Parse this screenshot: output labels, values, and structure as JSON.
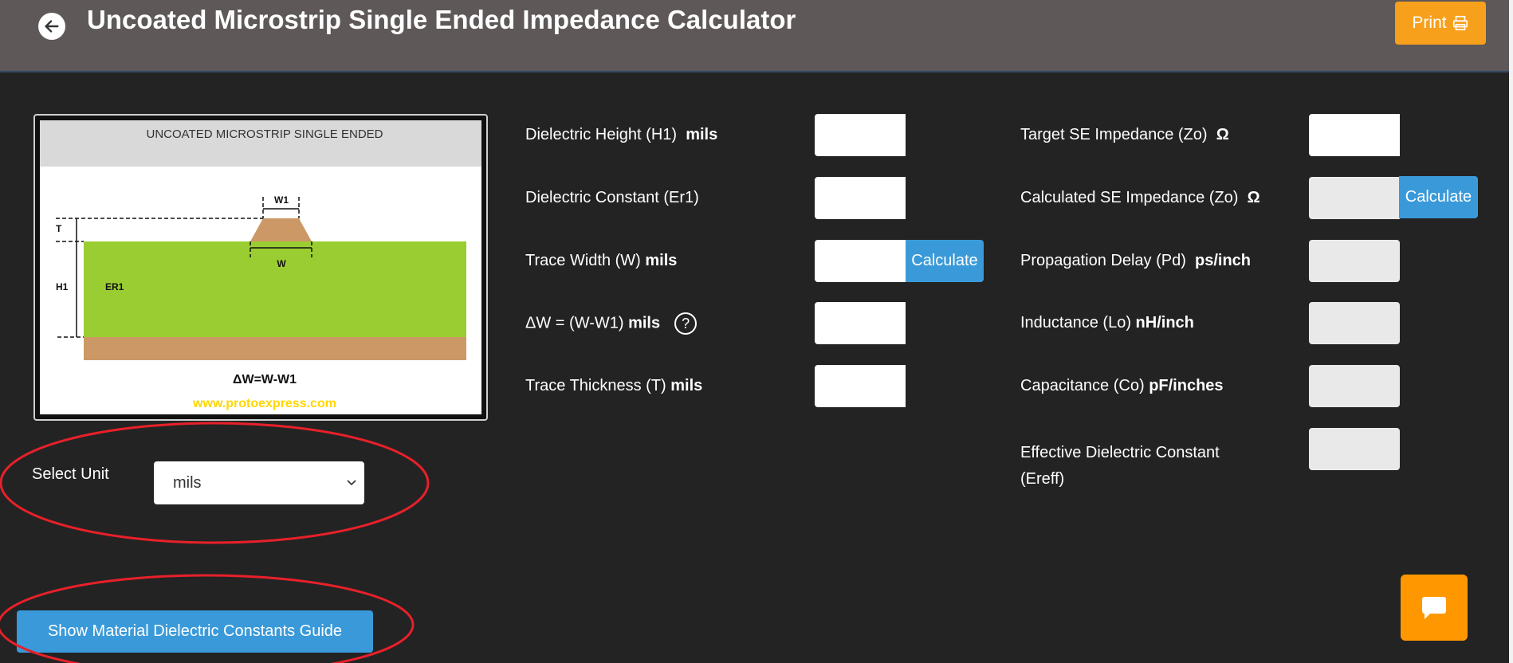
{
  "header": {
    "title": "Uncoated Microstrip Single Ended Impedance Calculator",
    "back_icon": "arrow-left-circle-icon",
    "print_label": "Print",
    "print_icon": "printer-icon"
  },
  "diagram": {
    "heading": "UNCOATED MICROSTRIP SINGLE ENDED",
    "labels": {
      "w1": "W1",
      "w": "W",
      "t": "T",
      "h1": "H1",
      "er1": "ER1"
    },
    "formula": "ΔW=W-W1",
    "website": "www.protoexpress.com",
    "colors": {
      "dielectric": "#9acd32",
      "copper": "#cc9966",
      "website": "#ffd700"
    }
  },
  "inputs": {
    "left": [
      {
        "label": "Dielectric Height (H1)",
        "unit": "mils",
        "value": ""
      },
      {
        "label": "Dielectric Constant (Er1)",
        "unit": "",
        "value": ""
      },
      {
        "label": "Trace Width (W)",
        "unit": "mils",
        "value": "",
        "button": "Calculate"
      },
      {
        "label": "ΔW = (W-W1)",
        "unit": "mils",
        "value": "",
        "help": "?"
      },
      {
        "label": "Trace Thickness (T)",
        "unit": "mils",
        "value": ""
      }
    ],
    "right": [
      {
        "label": "Target SE Impedance (Zo)",
        "unit": "Ω",
        "value": ""
      },
      {
        "label": "Calculated SE Impedance (Zo)",
        "unit": "Ω",
        "value": "",
        "button": "Calculate"
      },
      {
        "label": "Propagation Delay (Pd)",
        "unit": "ps/inch",
        "value": ""
      },
      {
        "label": "Inductance (Lo)",
        "unit": "nH/inch",
        "value": ""
      },
      {
        "label": "Capacitance (Co)",
        "unit": "pF/inches",
        "value": ""
      },
      {
        "label": "Effective Dielectric Constant",
        "label2": "(Ereff)",
        "unit": "",
        "value": ""
      }
    ]
  },
  "unit_select": {
    "label": "Select Unit",
    "value": "mils"
  },
  "guide_button": "Show Material Dielectric Constants Guide",
  "chat_icon": "chat-bubble-icon",
  "colors": {
    "header": "#5e5858",
    "accent_orange": "#f7a01c",
    "button_blue": "#3a9ad9",
    "annotation_red": "#e8202a"
  }
}
